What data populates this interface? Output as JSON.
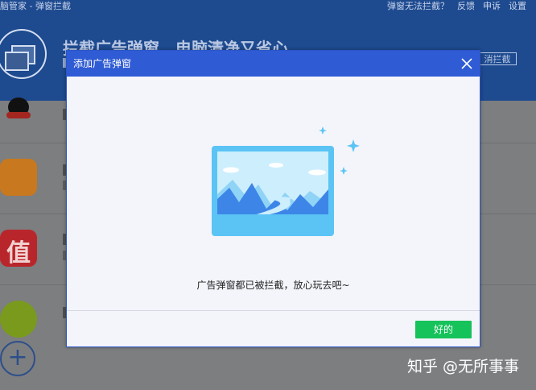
{
  "background_app": {
    "window_title": "脑管家 - 弹窗拦截",
    "actions": [
      "弹窗无法拦截？",
      "反馈",
      "申诉",
      "设置"
    ],
    "slogan": "拦截广告弹窗，电脑清净又省心",
    "cancel_button": "消拦截"
  },
  "dialog": {
    "title": "添加广告弹窗",
    "message": "广告弹窗都已被拦截，放心玩去吧~",
    "ok_label": "好的"
  },
  "watermark": "知乎 @无所事事",
  "colors": {
    "dialog_titlebar": "#2f5bd4",
    "ok_button": "#16c25a",
    "header": "#1e4a8f",
    "illustration_monitor": "#5bc4f5"
  }
}
